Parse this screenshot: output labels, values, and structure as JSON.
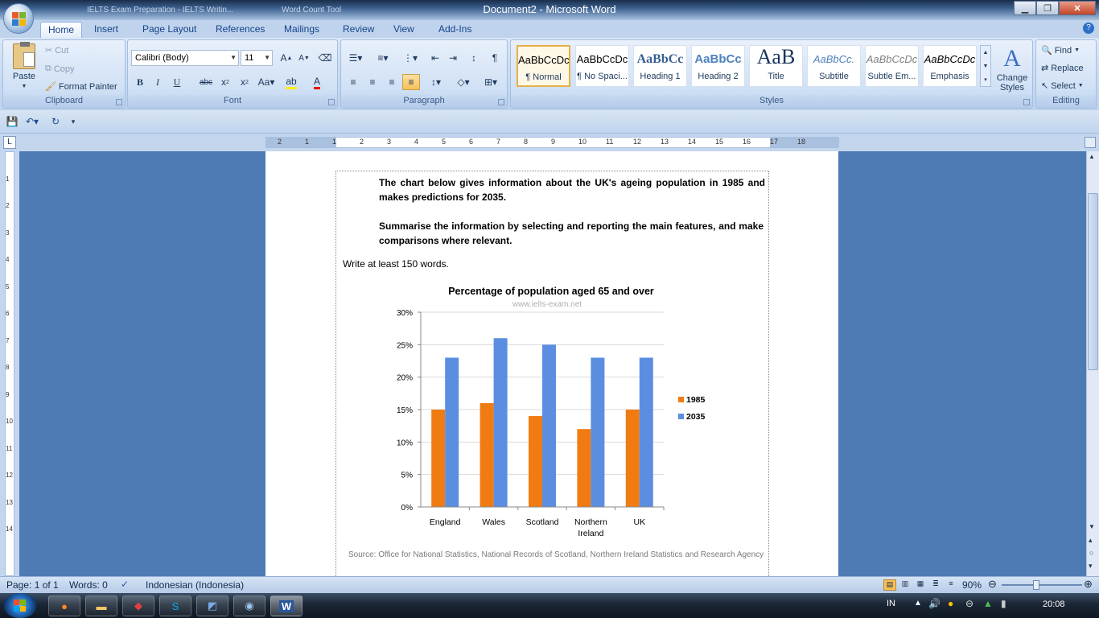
{
  "window": {
    "title": "Document2 - Microsoft Word",
    "ghost_tab1": "IELTS Exam Preparation - IELTS Writin...",
    "ghost_tab2": "Word Count Tool"
  },
  "tabs": [
    "Home",
    "Insert",
    "Page Layout",
    "References",
    "Mailings",
    "Review",
    "View",
    "Add-Ins"
  ],
  "clipboard": {
    "paste": "Paste",
    "cut": "Cut",
    "copy": "Copy",
    "format_painter": "Format Painter",
    "label": "Clipboard"
  },
  "font": {
    "name": "Calibri (Body)",
    "size": "11",
    "label": "Font"
  },
  "paragraph": {
    "label": "Paragraph"
  },
  "styles": {
    "items": [
      {
        "sample": "AaBbCcDc",
        "name": "¶ Normal"
      },
      {
        "sample": "AaBbCcDc",
        "name": "¶ No Spaci..."
      },
      {
        "sample": "AaBbCc",
        "name": "Heading 1"
      },
      {
        "sample": "AaBbCc",
        "name": "Heading 2"
      },
      {
        "sample": "AaB",
        "name": "Title"
      },
      {
        "sample": "AaBbCc.",
        "name": "Subtitle"
      },
      {
        "sample": "AaBbCcDc",
        "name": "Subtle Em..."
      },
      {
        "sample": "AaBbCcDc",
        "name": "Emphasis"
      }
    ],
    "change_styles": "Change Styles",
    "label": "Styles"
  },
  "editing": {
    "find": "Find",
    "replace": "Replace",
    "select": "Select",
    "label": "Editing"
  },
  "document": {
    "para1": "The chart below gives information about the UK's ageing population in 1985 and makes predictions for 2035.",
    "para2": "Summarise the information by selecting and reporting the main features, and make comparisons where relevant.",
    "para3": "Write at least 150 words.",
    "watermark": "www.ielts-exam.net",
    "source": "Source: Office for National Statistics, National Records of Scotland, Northern Ireland Statistics and Research Agency"
  },
  "chart_data": {
    "type": "bar",
    "title": "Percentage of population aged 65 and over",
    "categories": [
      "England",
      "Wales",
      "Scotland",
      "Northern Ireland",
      "UK"
    ],
    "series": [
      {
        "name": "1985",
        "values": [
          15,
          16,
          14,
          12,
          15
        ],
        "color": "#f07b12"
      },
      {
        "name": "2035",
        "values": [
          23,
          26,
          25,
          23,
          23
        ],
        "color": "#5b8ee0"
      }
    ],
    "y_ticks": [
      "0%",
      "5%",
      "10%",
      "15%",
      "20%",
      "25%",
      "30%"
    ],
    "ylim": [
      0,
      30
    ],
    "grid": true,
    "legend": "right"
  },
  "status": {
    "page": "Page: 1 of 1",
    "words": "Words: 0",
    "language": "Indonesian (Indonesia)",
    "zoom": "90%"
  },
  "taskbar": {
    "lang": "IN",
    "time": "20:08"
  },
  "ruler_h": [
    "2",
    "1",
    "1",
    "2",
    "3",
    "4",
    "5",
    "6",
    "7",
    "8",
    "9",
    "10",
    "11",
    "12",
    "13",
    "14",
    "15",
    "16",
    "17",
    "18"
  ]
}
